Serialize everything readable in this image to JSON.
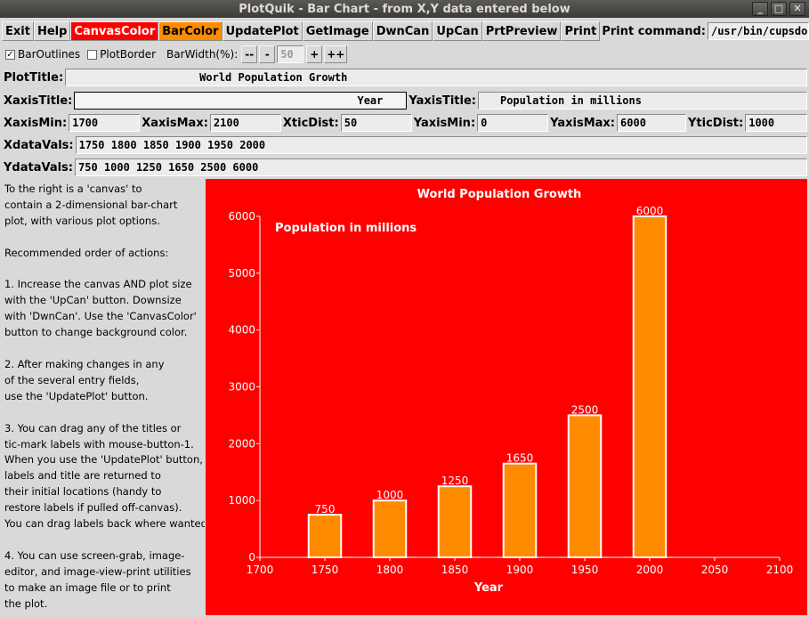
{
  "window": {
    "title": "PlotQuik - Bar Chart - from X,Y data entered below"
  },
  "toolbar": {
    "exit": "Exit",
    "help": "Help",
    "canvas_color": "CanvasColor",
    "bar_color": "BarColor",
    "update_plot": "UpdatePlot",
    "get_image": "GetImage",
    "dwn_can": "DwnCan",
    "up_can": "UpCan",
    "prt_preview": "PrtPreview",
    "print": "Print",
    "print_command_label": "Print command:",
    "print_command_value": "/usr/bin/cupsdoprint -P E"
  },
  "options": {
    "bar_outlines": "BarOutlines",
    "bar_outlines_checked": true,
    "plot_border": "PlotBorder",
    "plot_border_checked": false,
    "bar_width_label": "BarWidth(%):",
    "dec_big": "--",
    "dec": "-",
    "bar_width_value": "50",
    "inc": "+",
    "inc_big": "++"
  },
  "fields": {
    "plot_title_label": "PlotTitle:",
    "plot_title": "World Population Growth",
    "xaxis_title_label": "XaxisTitle:",
    "xaxis_title": "Year",
    "yaxis_title_label": "YaxisTitle:",
    "yaxis_title": "Population in millions",
    "xaxis_min_label": "XaxisMin:",
    "xaxis_min": "1700",
    "xaxis_max_label": "XaxisMax:",
    "xaxis_max": "2100",
    "xtic_dist_label": "XticDist:",
    "xtic_dist": "50",
    "yaxis_min_label": "YaxisMin:",
    "yaxis_min": "0",
    "yaxis_max_label": "YaxisMax:",
    "yaxis_max": "6000",
    "ytic_dist_label": "YticDist:",
    "ytic_dist": "1000",
    "xdata_label": "XdataVals:",
    "xdata": "1750 1800 1850 1900 1950 2000",
    "ydata_label": "YdataVals:",
    "ydata": "750 1000 1250 1650 2500 6000"
  },
  "help_text": "To the right is a 'canvas' to\ncontain a 2-dimensional bar-chart\nplot, with various plot options.\n\nRecommended order of actions:\n\n1. Increase the canvas AND plot size\nwith the 'UpCan' button. Downsize\nwith 'DwnCan'. Use the 'CanvasColor'\nbutton to change background color.\n\n2. After making changes in any\nof the several entry fields,\nuse the 'UpdatePlot' button.\n\n3. You can drag any of the titles or\ntic-mark labels with mouse-button-1.\nWhen you use the 'UpdatePlot' button,\nlabels and title are returned to\ntheir initial locations (handy to\nrestore labels if pulled off-canvas).\nYou can drag labels back where wanted.\n\n4. You can use screen-grab, image-\neditor, and image-view-print utilities\nto make an image file or to print\nthe plot.",
  "colors": {
    "canvas": "#ff0000",
    "bar": "#ff8c00",
    "bar_outline": "#ffffff",
    "text": "#ffffff"
  },
  "chart_data": {
    "type": "bar",
    "title": "World Population Growth",
    "xlabel": "Year",
    "ylabel": "Population in millions",
    "x": [
      1750,
      1800,
      1850,
      1900,
      1950,
      2000
    ],
    "values": [
      750,
      1000,
      1250,
      1650,
      2500,
      6000
    ],
    "xlim": [
      1700,
      2100
    ],
    "ylim": [
      0,
      6000
    ],
    "xticks": [
      1700,
      1750,
      1800,
      1850,
      1900,
      1950,
      2000,
      2050,
      2100
    ],
    "yticks": [
      0,
      1000,
      2000,
      3000,
      4000,
      5000,
      6000
    ],
    "bar_width_percent": 50,
    "data_labels": true,
    "grid": false
  }
}
